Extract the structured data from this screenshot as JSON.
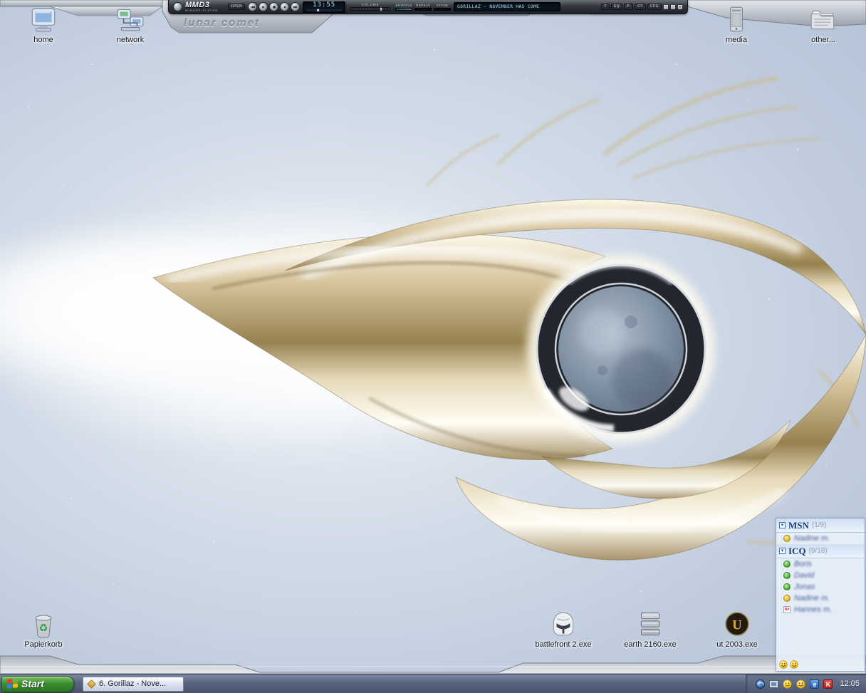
{
  "wallpaper": {
    "watermark": "lunar comet"
  },
  "player": {
    "brand": "MMD3",
    "brand_sub": "WINAMP-PLAYER",
    "open_label": "OPEN",
    "transport": [
      "◀◀",
      "▶",
      "▮▮",
      "■",
      "▶▶"
    ],
    "time": "13:55",
    "volume_label": "VOLUME",
    "toggles": [
      "SHUFFLE",
      "REPEAT",
      "CFADE"
    ],
    "track": "GORILLAZ - NOVEMBER HAS COME",
    "small_buttons": [
      "T",
      "EQ",
      "P.",
      "CT",
      "CFG"
    ],
    "window_buttons": [
      "–",
      "▫",
      "✕"
    ]
  },
  "desktop_icons": [
    {
      "label": "home"
    },
    {
      "label": "network"
    },
    {
      "label": "media"
    },
    {
      "label": "other..."
    },
    {
      "label": "Papierkorb"
    },
    {
      "label": "battlefront 2.exe"
    },
    {
      "label": "earth 2160.exe"
    },
    {
      "label": "ut 2003.exe"
    }
  ],
  "buddy_list": {
    "groups": [
      {
        "name": "MSN",
        "count": "(1/9)"
      },
      {
        "name": "ICQ",
        "count": "(9/18)"
      }
    ],
    "msn_contacts": [
      {
        "name": "Nadine m.",
        "status": "away"
      }
    ],
    "icq_contacts": [
      {
        "name": "Boris",
        "status": "online"
      },
      {
        "name": "David",
        "status": "online"
      },
      {
        "name": "Jonas",
        "status": "online"
      },
      {
        "name": "Nadine m.",
        "status": "away"
      },
      {
        "name": "Hannes m.",
        "status": "na"
      }
    ]
  },
  "taskbar": {
    "start_label": "Start",
    "tasks": [
      {
        "label": "6. Gorillaz - Nove..."
      }
    ],
    "clock": "12:05"
  },
  "glyphs": {
    "collapse": "▾",
    "recycle": "♻",
    "ut_logo": "U",
    "na_badge": "N#",
    "e_icon": "e",
    "k_icon": "K"
  },
  "tray_icons": [
    "globe-icon",
    "display-icon",
    "smiley-icon",
    "smiley-icon",
    "e-icon",
    "red-k-icon"
  ],
  "colors": {
    "lcd": "#b9e4f2",
    "metal": "#c9b78e",
    "start_green": "#3b8f31",
    "sky": "#c0ccde"
  }
}
